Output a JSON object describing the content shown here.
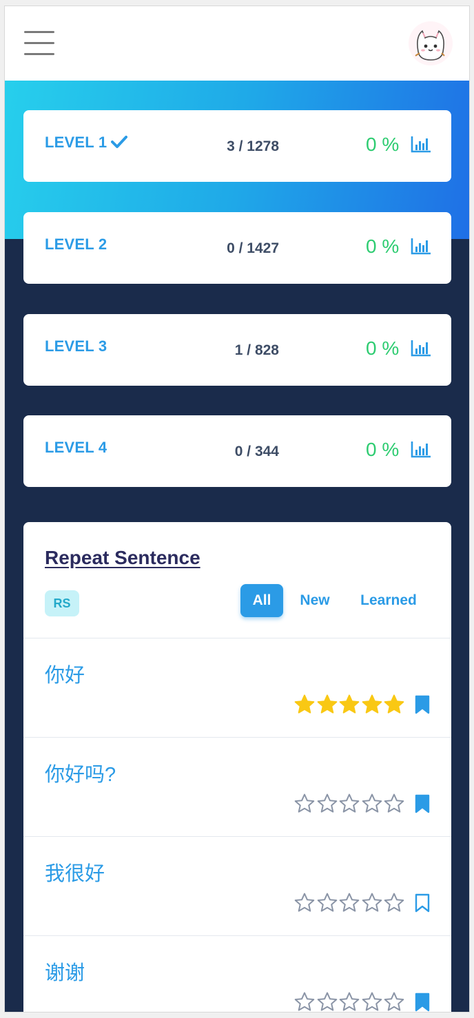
{
  "header": {
    "menu_icon": "hamburger-menu-icon",
    "avatar_icon": "cat-avatar-icon"
  },
  "colors": {
    "accent": "#2b9be6",
    "percent": "#2ecc71",
    "background": "#1a2b4b",
    "star_filled": "#f9c814",
    "star_empty": "#8a94a6"
  },
  "levels": [
    {
      "name": "LEVEL 1",
      "completed": true,
      "count": "3 / 1278",
      "percent": "0 %"
    },
    {
      "name": "LEVEL 2",
      "completed": false,
      "count": "0 / 1427",
      "percent": "0 %"
    },
    {
      "name": "LEVEL 3",
      "completed": false,
      "count": "1 / 828",
      "percent": "0 %"
    },
    {
      "name": "LEVEL 4",
      "completed": false,
      "count": "0 / 344",
      "percent": "0 %"
    }
  ],
  "repeat_sentence": {
    "title": "Repeat Sentence",
    "badge": "RS",
    "filters": {
      "all": "All",
      "new": "New",
      "learned": "Learned",
      "active": "All"
    },
    "items": [
      {
        "text": "你好",
        "rating": 5,
        "bookmarked": true
      },
      {
        "text": "你好吗?",
        "rating": 0,
        "bookmarked": true
      },
      {
        "text": "我很好",
        "rating": 0,
        "bookmarked": false
      },
      {
        "text": "谢谢",
        "rating": 0,
        "bookmarked": true
      }
    ]
  }
}
